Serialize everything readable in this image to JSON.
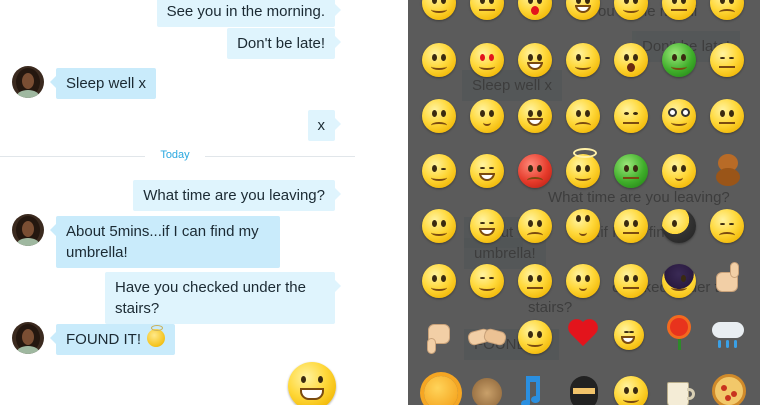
{
  "chat": {
    "messages": [
      {
        "text": "See you in the morning.",
        "direction": "out"
      },
      {
        "text": "Don't be late!",
        "direction": "out"
      },
      {
        "text": "Sleep well x",
        "direction": "in"
      },
      {
        "text": "x",
        "direction": "out"
      },
      {
        "text": "What time are you leaving?",
        "direction": "out"
      },
      {
        "text": "About 5mins...if I can find my umbrella!",
        "direction": "in"
      },
      {
        "text": "Have you checked under the stairs?",
        "direction": "out"
      },
      {
        "text": "FOUND IT!",
        "direction": "in"
      }
    ],
    "day_separator": "Today"
  },
  "emoji_panel": {
    "ghost_texts": {
      "morning_fragment": "ou in the morni",
      "late": "Don't be late!",
      "sleep": "Sleep well x",
      "time": "What time are you leaving?",
      "about_a": "About",
      "about_b": "ns...if I can find m",
      "umbrella": "umbrella!",
      "checked": "checked under the",
      "stairs": "stairs?",
      "found": "FOUND IT!"
    }
  },
  "colors": {
    "accent": "#2aa8e0",
    "bubble_out": "#dff4fd",
    "bubble_in": "#c9ebfb",
    "panel_bg": "#5b5b5b"
  }
}
